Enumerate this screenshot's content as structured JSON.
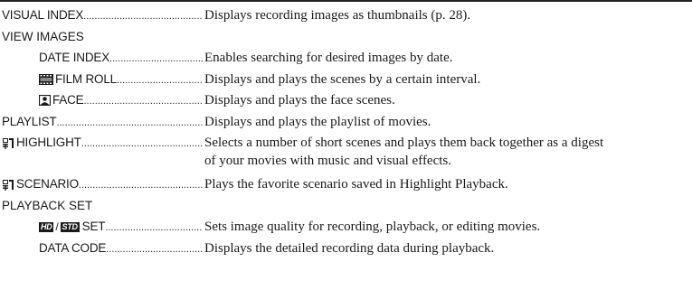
{
  "rows": [
    {
      "term": "VISUAL INDEX",
      "desc": "Displays recording images as thumbnails (p. 28)."
    },
    {
      "heading": "VIEW IMAGES"
    },
    {
      "term": "DATE INDEX",
      "desc": "Enables searching for desired images by date."
    },
    {
      "term": "FILM ROLL",
      "icon": "film-roll-icon",
      "desc": "Displays and plays the scenes by a certain interval."
    },
    {
      "term": "FACE",
      "icon": "face-icon",
      "desc": "Displays and plays the face scenes."
    },
    {
      "term": "PLAYLIST",
      "desc": "Displays and plays the playlist of movies."
    },
    {
      "term": "HIGHLIGHT",
      "icon": "highlight-icon",
      "desc": "Selects a number of short scenes and plays them back together as a digest",
      "desc2": "of your movies with music and visual effects."
    },
    {
      "term": "SCENARIO",
      "icon": "highlight-icon",
      "desc": "Plays the favorite scenario saved in Highlight Playback."
    },
    {
      "heading": "PLAYBACK SET"
    },
    {
      "term": "SET",
      "icon": "hd-sd-badges",
      "badge_hd": "HD",
      "badge_sd": "STD",
      "badge_sep": "/",
      "desc": "Sets image quality for recording, playback, or editing movies."
    },
    {
      "term": "DATA CODE",
      "desc": "Displays the detailed recording data during playback."
    }
  ]
}
